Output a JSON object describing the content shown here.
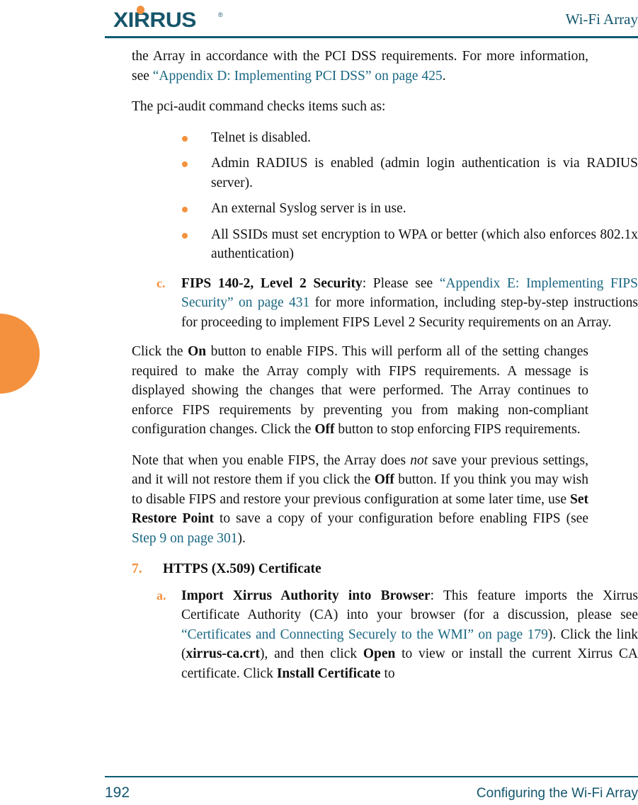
{
  "header": {
    "logo_text": "XIRRUS",
    "logo_registered_mark": "®",
    "title": "Wi-Fi Array"
  },
  "colors": {
    "brand_teal": "#17566B",
    "rule_teal": "#0E5B75",
    "link_teal": "#1A6782",
    "accent_orange": "#F4913E",
    "body_text": "#111111"
  },
  "body": {
    "para_1": {
      "run_1": "the Array in accordance with the PCI DSS requirements. For more information, see ",
      "link_1": "“Appendix D: Implementing PCI DSS” on page 425",
      "run_2": "."
    },
    "para_2": "The pci-audit command checks items such as:",
    "bullets": [
      "Telnet is disabled.",
      "Admin RADIUS is enabled (admin login authentication is via RADIUS server).",
      "An external Syslog server is in use.",
      "All SSIDs must set encryption to WPA or better (which also enforces 802.1x authentication)"
    ],
    "item_c": {
      "marker": "c.",
      "bold_lead": "FIPS 140-2, Level 2 Security",
      "run_1": ": Please see ",
      "link_1": "“Appendix E: Implementing FIPS Security” on page 431",
      "run_2": " for more information, including step-by-step instructions for proceeding to implement FIPS Level 2 Security requirements on an Array."
    },
    "para_3": {
      "run_1": "Click the ",
      "bold_1": "On",
      "run_2": " button to enable FIPS. This will perform all of the setting changes required to make the Array comply with FIPS requirements. A message is displayed showing the changes that were performed. The Array continues to enforce FIPS requirements by preventing you from making non-compliant configuration changes. Click the ",
      "bold_2": "Off",
      "run_3": " button to stop enforcing FIPS requirements."
    },
    "para_4": {
      "run_1": "Note that when you enable FIPS, the Array does ",
      "italic_1": "not",
      "run_2": " save your previous settings, and it will not restore them if you click the ",
      "bold_1": "Off",
      "run_3": " button. If you think you may wish to disable FIPS and restore your previous configuration at some later time, use ",
      "bold_2": "Set Restore Point",
      "run_4": " to save a copy of your configuration before enabling FIPS (see ",
      "link_1": "Step 9 on page 301",
      "run_5": ")."
    },
    "item_7": {
      "marker": "7.",
      "heading": "HTTPS (X.509) Certificate"
    },
    "item_a": {
      "marker": "a.",
      "bold_lead": "Import Xirrus Authority into Browser",
      "run_1": ": This feature imports the Xirrus Certificate Authority (CA) into your browser (for a discussion, please see ",
      "link_1": "“Certificates and Connecting Securely to the WMI” on page 179",
      "run_2": "). Click the link (",
      "bold_1": "xirrus-ca.crt",
      "run_3": "), and then click ",
      "bold_2": "Open",
      "run_4": " to view or install the current Xirrus CA certificate. Click ",
      "bold_3": "Install Certificate",
      "run_5": " to"
    }
  },
  "footer": {
    "page_number": "192",
    "chapter": "Configuring the Wi-Fi Array"
  }
}
